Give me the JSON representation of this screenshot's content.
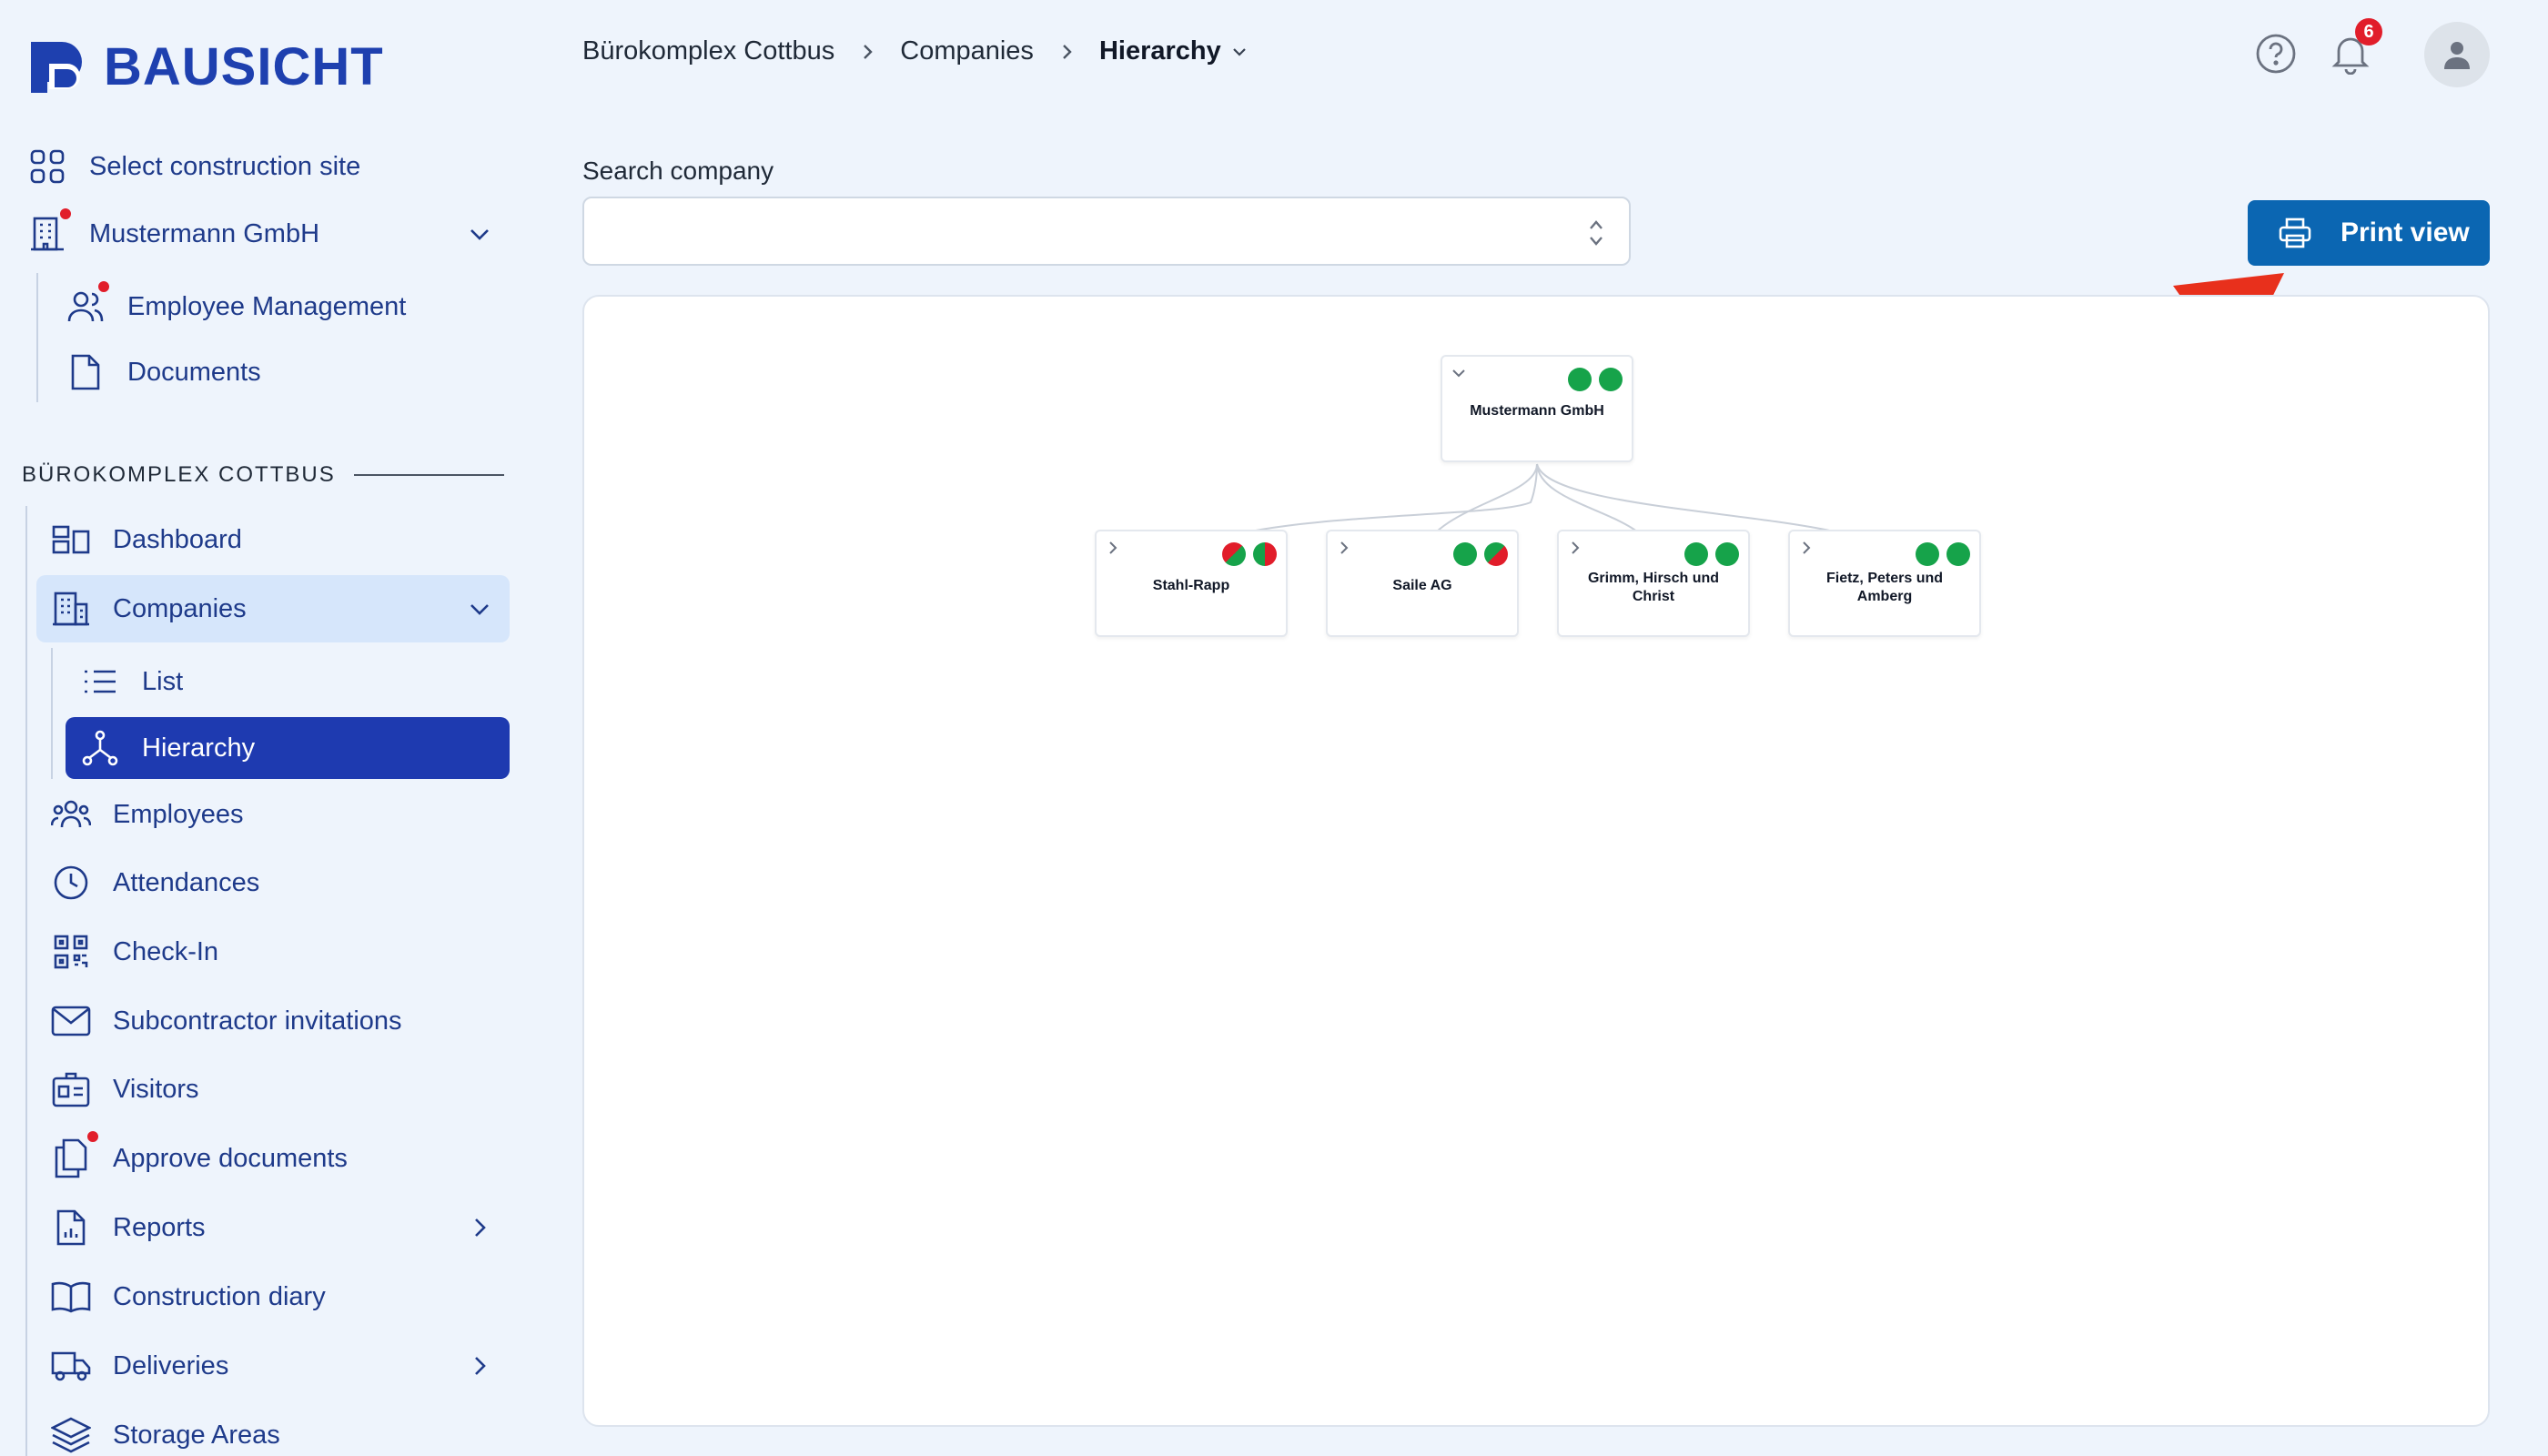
{
  "brand": {
    "name": "BAUSICHT",
    "color": "#1e40af"
  },
  "sidebar": {
    "top_items": [
      {
        "label": "Select construction site",
        "icon": "grid-icon"
      },
      {
        "label": "Mustermann GmbH",
        "icon": "building-icon",
        "has_alert": true
      },
      {
        "label": "Employee Management",
        "icon": "users-icon",
        "has_alert": true
      },
      {
        "label": "Documents",
        "icon": "document-icon"
      }
    ],
    "section_title": "BÜROKOMPLEX COTTBUS",
    "items": [
      {
        "label": "Dashboard",
        "icon": "dashboard-icon"
      },
      {
        "label": "Companies",
        "icon": "building-icon",
        "expanded": true
      },
      {
        "label": "List",
        "icon": "list-icon"
      },
      {
        "label": "Hierarchy",
        "icon": "hierarchy-icon",
        "active": true
      },
      {
        "label": "Employees",
        "icon": "users-group-icon"
      },
      {
        "label": "Attendances",
        "icon": "clock-icon"
      },
      {
        "label": "Check-In",
        "icon": "qr-code-icon"
      },
      {
        "label": "Subcontractor invitations",
        "icon": "envelope-icon"
      },
      {
        "label": "Visitors",
        "icon": "id-card-icon"
      },
      {
        "label": "Approve documents",
        "icon": "documents-icon",
        "has_alert": true
      },
      {
        "label": "Reports",
        "icon": "report-icon",
        "has_submenu": true
      },
      {
        "label": "Construction diary",
        "icon": "book-icon"
      },
      {
        "label": "Deliveries",
        "icon": "truck-icon",
        "has_submenu": true
      },
      {
        "label": "Storage Areas",
        "icon": "layers-icon"
      }
    ]
  },
  "header": {
    "breadcrumb": [
      "Bürokomplex Cottbus",
      "Companies",
      "Hierarchy"
    ],
    "notification_count": "6"
  },
  "main": {
    "search_label": "Search company",
    "search_value": "",
    "print_label": "Print view",
    "hierarchy": {
      "root": {
        "name": "Mustermann GmbH",
        "status": [
          "green",
          "green"
        ]
      },
      "children": [
        {
          "name": "Stahl-Rapp",
          "status": [
            "mixed",
            "mixed"
          ]
        },
        {
          "name": "Saile AG",
          "status": [
            "green",
            "mixed"
          ]
        },
        {
          "name": "Grimm, Hirsch und Christ",
          "status": [
            "green",
            "green"
          ]
        },
        {
          "name": "Fietz, Peters und Amberg",
          "status": [
            "green",
            "green"
          ]
        }
      ]
    }
  },
  "colors": {
    "accent": "#1e3ab0",
    "button": "#0b66b2",
    "alert": "#e11d2a",
    "status_green": "#16a34a",
    "status_red": "#e11d2a",
    "annotation_arrow": "#e8301c"
  }
}
